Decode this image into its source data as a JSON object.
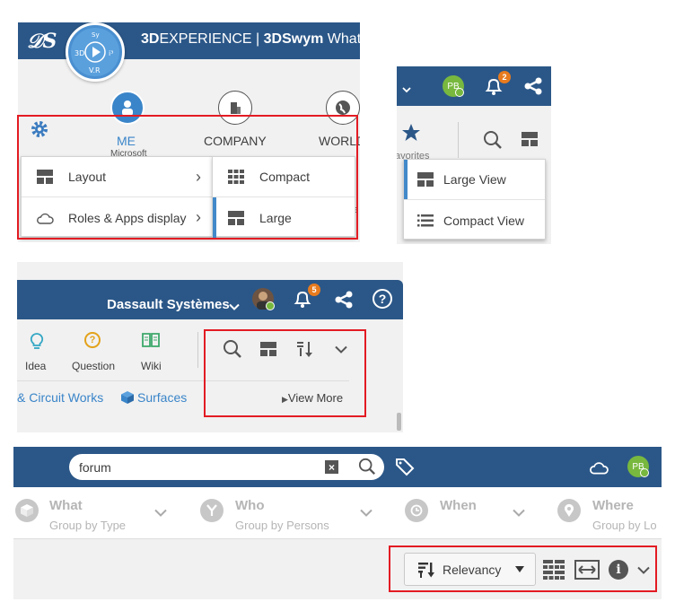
{
  "panel1": {
    "brand": {
      "bold": "3D",
      "name": "EXPERIENCE",
      "sep": " | ",
      "app": "3DSwym",
      "cut": " What's"
    },
    "compass": {
      "top": "V.R",
      "left": "3D",
      "right": "i³",
      "topTag": "Sy"
    },
    "tabs": [
      {
        "label": "ME"
      },
      {
        "label": "COMPANY"
      },
      {
        "label": "WORLD"
      }
    ],
    "bg_text": [
      "Microsoft",
      "e"
    ],
    "menu": [
      {
        "label": "Layout",
        "arrow": "›"
      },
      {
        "label": "Roles & Apps display",
        "arrow": "›"
      }
    ],
    "submenu": [
      {
        "label": "Compact"
      },
      {
        "label": "Large"
      }
    ]
  },
  "panel2": {
    "avatar": "PB",
    "badge": "2",
    "favorites": "avorites",
    "menu": [
      {
        "label": "Large View"
      },
      {
        "label": "Compact View"
      }
    ]
  },
  "panel3": {
    "company": "Dassault Systèmes",
    "badge": "5",
    "tools": [
      {
        "label": "Idea"
      },
      {
        "label": "Question"
      },
      {
        "label": "Wiki"
      }
    ],
    "links": [
      {
        "label": "& Circuit Works"
      },
      {
        "label": "Surfaces"
      }
    ],
    "view_more": "View More"
  },
  "panel4": {
    "search_value": "forum",
    "avatar": "PB",
    "facets": [
      {
        "title": "What",
        "sub": "Group by Type"
      },
      {
        "title": "Who",
        "sub": "Group by Persons"
      },
      {
        "title": "When",
        "sub": ""
      },
      {
        "title": "Where",
        "sub": "Group by Lo"
      }
    ],
    "sort_label": "Relevancy"
  },
  "colors": {
    "navy": "#2b5788",
    "accent_blue": "#4289c9",
    "red_highlight": "#e31b23",
    "badge_orange": "#e87b1e",
    "avatar_green": "#78b83f"
  }
}
